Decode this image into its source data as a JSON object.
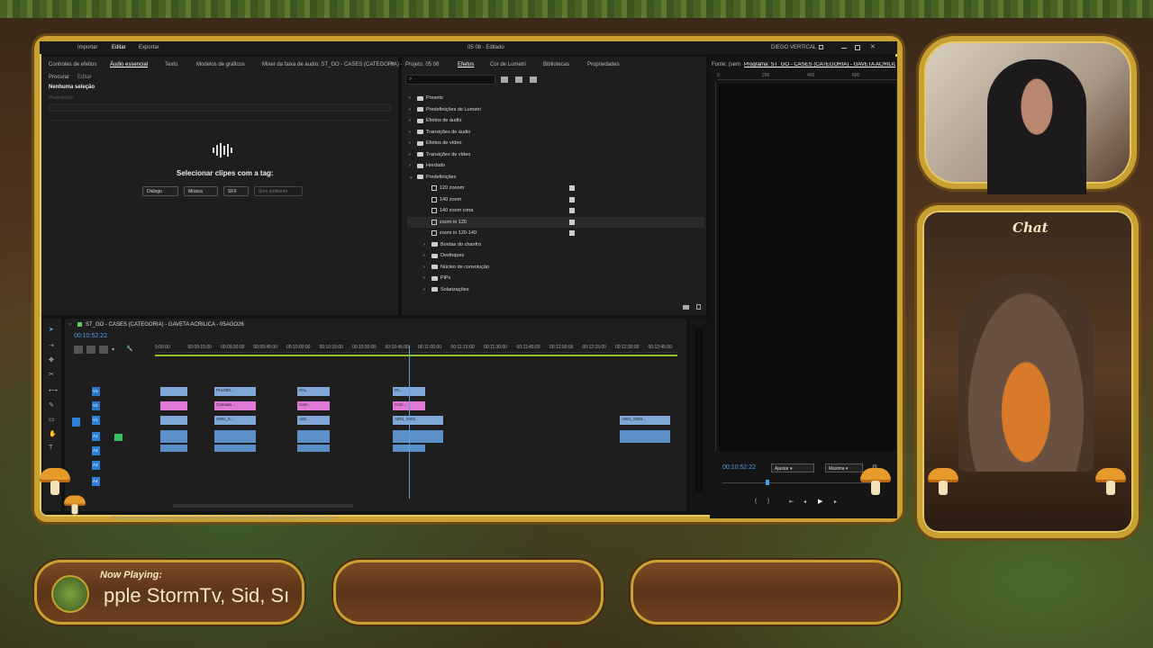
{
  "window": {
    "menu": [
      "Importar",
      "Editar",
      "Exportar"
    ],
    "title": "05 08 - Editado",
    "workspace": "DIEGO VERTICAL"
  },
  "left_panel": {
    "tabs": [
      "Controles de efeitos",
      "Áudio essencial",
      "Texto",
      "Modelos de gráficos",
      "Mixer da faixa de áudio: ST_GO - CASES (CATEGORIA) -"
    ],
    "subtabs": [
      "Procurar",
      "Editar"
    ],
    "no_selection": "Nenhuma seleção",
    "preset_label": "Predefinição",
    "prompt": "Selecionar clipes com a tag:",
    "tags": [
      "Diálogo",
      "Música",
      "SFX",
      "Som ambiente"
    ]
  },
  "effects_panel": {
    "tabs": [
      "Projeto: 05 08",
      "Efeitos",
      "Cor de Lumetri",
      "Bibliotecas",
      "Propriedades"
    ],
    "items": [
      {
        "label": "Presets",
        "kind": "folder",
        "indent": 0
      },
      {
        "label": "Predefinições de Lumetri",
        "kind": "folder",
        "indent": 0
      },
      {
        "label": "Efeitos de áudio",
        "kind": "folder",
        "indent": 0
      },
      {
        "label": "Transições de áudio",
        "kind": "folder",
        "indent": 0
      },
      {
        "label": "Efeitos de vídeo",
        "kind": "folder",
        "indent": 0
      },
      {
        "label": "Transições de vídeo",
        "kind": "folder",
        "indent": 0
      },
      {
        "label": "Herdado",
        "kind": "folder",
        "indent": 0
      },
      {
        "label": "Predefinições",
        "kind": "folder-open",
        "indent": 0
      },
      {
        "label": "120 zooom",
        "kind": "preset",
        "indent": 1
      },
      {
        "label": "140 zoom",
        "kind": "preset",
        "indent": 1
      },
      {
        "label": "140 zoom cima",
        "kind": "preset",
        "indent": 1
      },
      {
        "label": "zoom in 120",
        "kind": "preset",
        "indent": 1
      },
      {
        "label": "zoom in 120-140",
        "kind": "preset",
        "indent": 1
      },
      {
        "label": "Bordas do chanfro",
        "kind": "folder",
        "indent": 1
      },
      {
        "label": "Desfoques",
        "kind": "folder",
        "indent": 1
      },
      {
        "label": "Núcleo de convolução",
        "kind": "folder",
        "indent": 1
      },
      {
        "label": "PiPs",
        "kind": "folder",
        "indent": 1
      },
      {
        "label": "Solarizações",
        "kind": "folder",
        "indent": 1
      }
    ]
  },
  "program_monitor": {
    "tabs": [
      "Fonte: (sem",
      "Programa: ST_GO - CASES (CATEGORIA) - GAVETA ACRILICA"
    ],
    "ruler": [
      "0",
      "200",
      "400",
      "600"
    ],
    "timecode": "00:10:52:22",
    "fit": "Ajustar",
    "quality": "Máxima"
  },
  "timeline": {
    "sequence": "ST_GO - CASES (CATEGORIA) - GAVETA ACRILICA - 05AGO26",
    "timecode": "00:10:52:22",
    "ruler": [
      "9:00:00",
      "00:09:15:00",
      "00:09:30:00",
      "00:09:45:00",
      "00:10:00:00",
      "00:10:15:00",
      "00:10:30:00",
      "00:10:45:00",
      "00:11:00:00",
      "00:11:15:00",
      "00:11:30:00",
      "00:11:45:00",
      "00:12:00:00",
      "00:12:15:00",
      "00:12:30:00",
      "00:12:45:00"
    ],
    "video_tracks": [
      "V3",
      "V2",
      "V1"
    ],
    "audio_tracks": [
      "A1",
      "A2",
      "A3",
      "A4"
    ],
    "clips_v3": [
      "PALMEI...",
      "PAL...",
      "PA..."
    ],
    "clips_v2": [
      "Camada...",
      "Cam...",
      "Cam..."
    ],
    "clips_v1": [
      "A001_0...",
      "A00...",
      "A001_0003...",
      "A001_0003..."
    ],
    "fx": "fx",
    "status_hint": "Clique em espaço vazio e arraste para selecionar o letreiro. Use as teclas Shift+Alt+Ctrl para obter mais opções."
  },
  "overlay": {
    "chat_title": "Chat",
    "now_playing_label": "Now Playing:",
    "now_playing_text": "pple StormTv, Sid, Sı"
  },
  "colors": {
    "frame_gold": "#c9a032",
    "clip_video": "#7fa8d8",
    "clip_pink": "#e07ad6",
    "clip_audio": "#5a8fc8",
    "playhead": "#5a9fe0",
    "accent_blue": "#2d7fd8"
  }
}
